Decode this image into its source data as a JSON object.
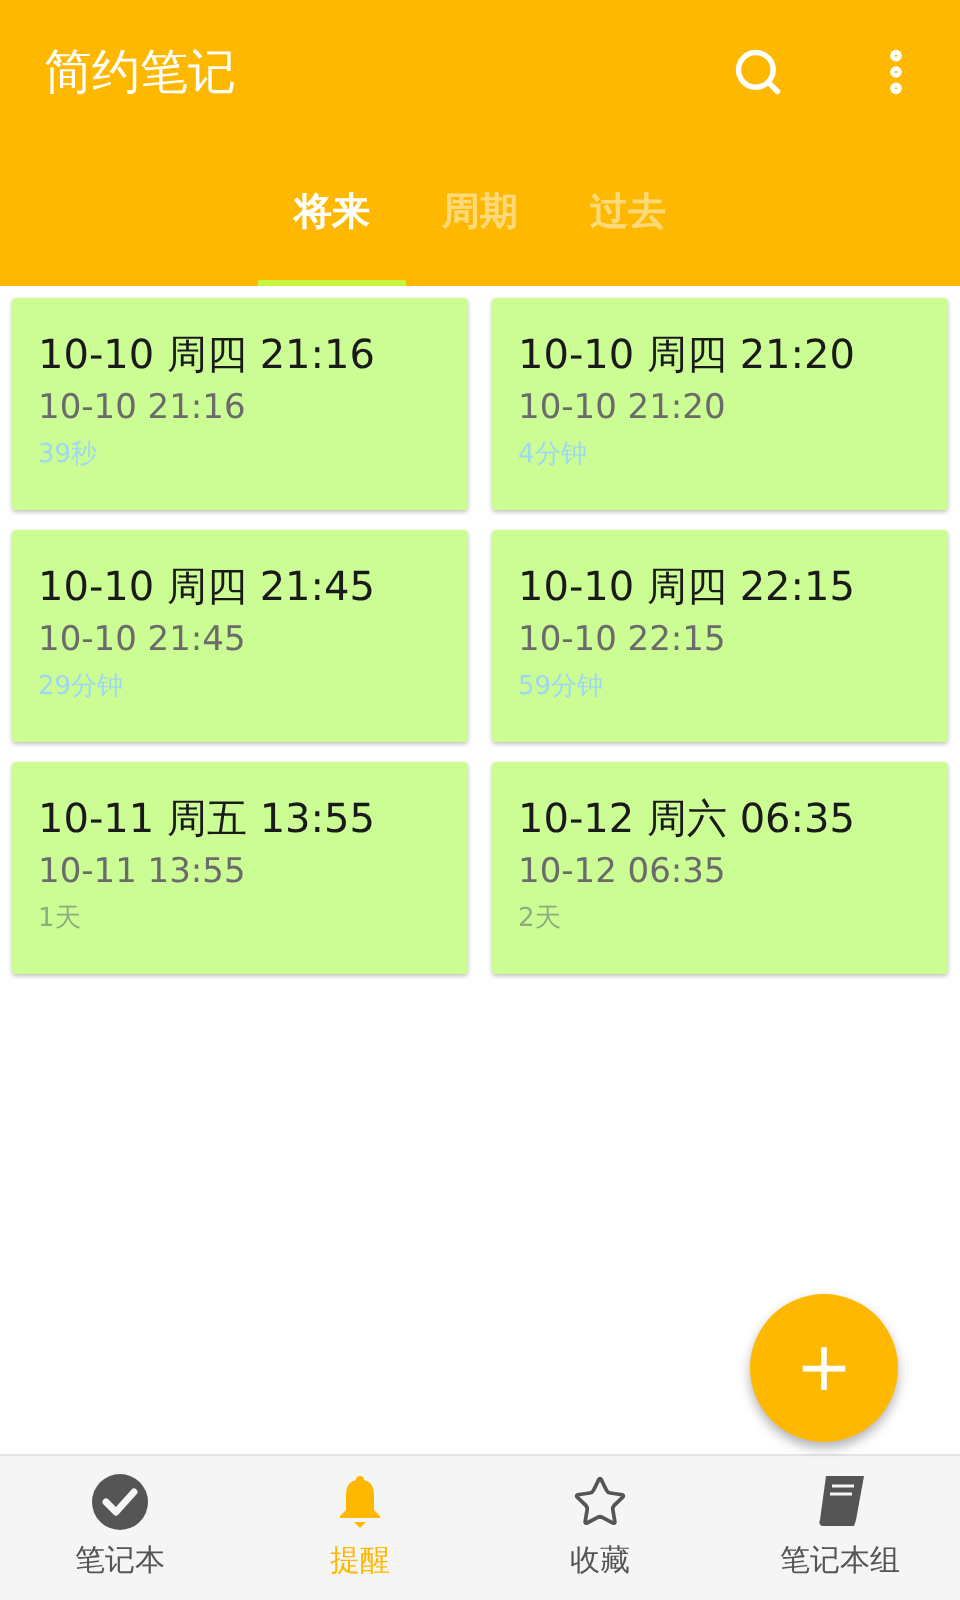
{
  "app_bar": {
    "title": "简约笔记"
  },
  "tabs": [
    {
      "label": "将来",
      "selected": true
    },
    {
      "label": "周期",
      "selected": false
    },
    {
      "label": "过去",
      "selected": false
    }
  ],
  "reminders": [
    {
      "title": "10-10 周四 21:16",
      "time": "10-10 21:16",
      "countdown": "39秒",
      "color": "#9ed8f0"
    },
    {
      "title": "10-10 周四 21:20",
      "time": "10-10 21:20",
      "countdown": "4分钟",
      "color": "#9ed8f0"
    },
    {
      "title": "10-10 周四 21:45",
      "time": "10-10 21:45",
      "countdown": "29分钟",
      "color": "#9ed8f0"
    },
    {
      "title": "10-10 周四 22:15",
      "time": "10-10 22:15",
      "countdown": "59分钟",
      "color": "#9ed8f0"
    },
    {
      "title": "10-11 周五 13:55",
      "time": "10-11 13:55",
      "countdown": "1天",
      "color": "#8fac80"
    },
    {
      "title": "10-12 周六 06:35",
      "time": "10-12 06:35",
      "countdown": "2天",
      "color": "#8fac80"
    }
  ],
  "fab": {
    "label": "+"
  },
  "bottom_nav": [
    {
      "label": "笔记本",
      "kind": "check",
      "selected": false
    },
    {
      "label": "提醒",
      "kind": "bell",
      "selected": true
    },
    {
      "label": "收藏",
      "kind": "star",
      "selected": false
    },
    {
      "label": "笔记本组",
      "kind": "book",
      "selected": false
    }
  ]
}
